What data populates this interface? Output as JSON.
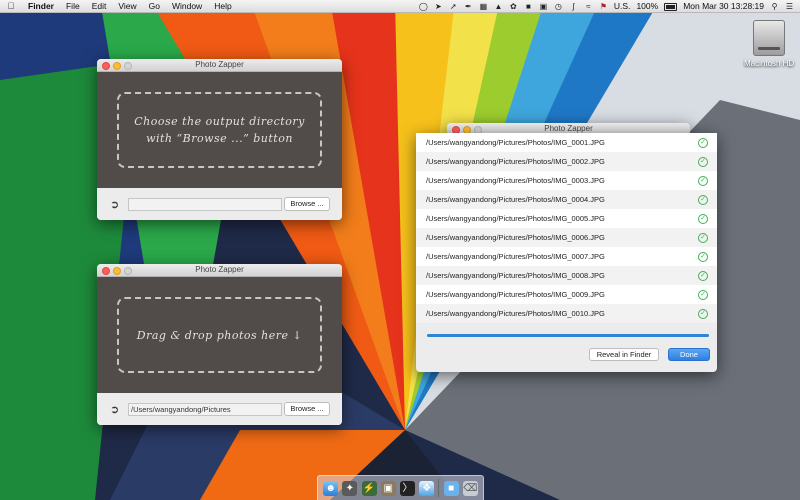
{
  "menubar": {
    "app": "Finder",
    "items": [
      "File",
      "Edit",
      "View",
      "Go",
      "Window",
      "Help"
    ],
    "status_icons": [
      "circle-icon",
      "cursor-icon",
      "arrow-icon",
      "feather-icon",
      "app-icon",
      "hat-icon",
      "leaf-icon",
      "lock-icon",
      "bag-icon",
      "clock-icon",
      "bluetooth-icon",
      "wifi-icon"
    ],
    "flag": "U.S.",
    "battery": "100%",
    "datetime": "Mon Mar 30  13:28:19"
  },
  "desktop": {
    "disk_label": "Macintosh HD"
  },
  "window_output": {
    "title": "Photo Zapper",
    "drop_text_line1": "Choose the output directory",
    "drop_text_line2": "with “Browse ...” button",
    "path_value": "",
    "browse_label": "Browse ..."
  },
  "window_input": {
    "title": "Photo Zapper",
    "drop_text": "Drag & drop photos here  ↓",
    "path_value": "/Users/wangyandong/Pictures",
    "browse_label": "Browse ..."
  },
  "window_back": {
    "title": "Photo Zapper"
  },
  "window_list": {
    "files": [
      "/Users/wangyandong/Pictures/Photos/IMG_0001.JPG",
      "/Users/wangyandong/Pictures/Photos/IMG_0002.JPG",
      "/Users/wangyandong/Pictures/Photos/IMG_0003.JPG",
      "/Users/wangyandong/Pictures/Photos/IMG_0004.JPG",
      "/Users/wangyandong/Pictures/Photos/IMG_0005.JPG",
      "/Users/wangyandong/Pictures/Photos/IMG_0006.JPG",
      "/Users/wangyandong/Pictures/Photos/IMG_0007.JPG",
      "/Users/wangyandong/Pictures/Photos/IMG_0008.JPG",
      "/Users/wangyandong/Pictures/Photos/IMG_0009.JPG",
      "/Users/wangyandong/Pictures/Photos/IMG_0010.JPG"
    ],
    "progress_fraction": 1.0,
    "reveal_label": "Reveal in Finder",
    "done_label": "Done"
  },
  "dock": {
    "icons": [
      "finder-icon",
      "launchpad-icon",
      "photo-zapper-icon",
      "preview-icon",
      "terminal-icon",
      "safari-icon",
      "folder-icon",
      "trash-icon"
    ]
  },
  "colors": {
    "drop_bg": "#514c4a",
    "accent": "#2f86d6",
    "check": "#3fb34f"
  }
}
